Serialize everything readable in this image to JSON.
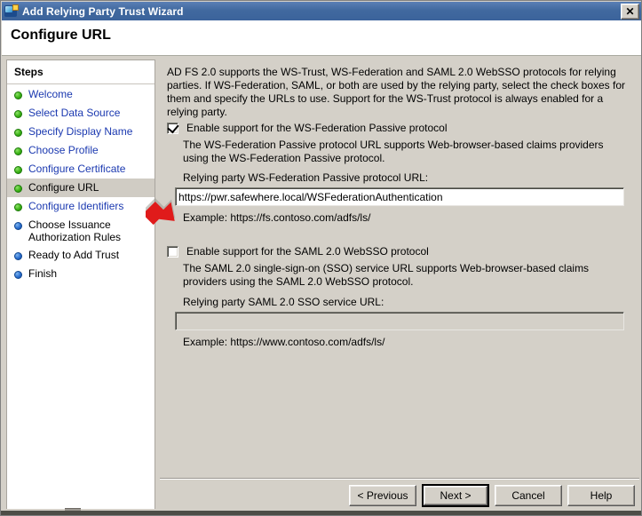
{
  "window": {
    "title": "Add Relying Party Trust Wizard",
    "icon": "network-globe-icon",
    "close_label": "✕"
  },
  "header": {
    "title": "Configure URL"
  },
  "sidebar": {
    "title": "Steps",
    "items": [
      {
        "label": "Welcome",
        "state": "done"
      },
      {
        "label": "Select Data Source",
        "state": "done"
      },
      {
        "label": "Specify Display Name",
        "state": "done"
      },
      {
        "label": "Choose Profile",
        "state": "done"
      },
      {
        "label": "Configure Certificate",
        "state": "done"
      },
      {
        "label": "Configure URL",
        "state": "current"
      },
      {
        "label": "Configure Identifiers",
        "state": "done"
      },
      {
        "label": "Choose Issuance Authorization Rules",
        "state": "todo"
      },
      {
        "label": "Ready to Add Trust",
        "state": "todo"
      },
      {
        "label": "Finish",
        "state": "todo"
      }
    ]
  },
  "main": {
    "intro": "AD FS 2.0 supports the WS-Trust, WS-Federation and SAML 2.0 WebSSO protocols for relying parties.  If WS-Federation, SAML, or both are used by the relying party, select the check boxes for them and specify the URLs to use.  Support for the WS-Trust protocol is always enabled for a relying party.",
    "wsfed": {
      "checkbox_label": "Enable support for the WS-Federation Passive protocol",
      "checked": true,
      "description": "The WS-Federation Passive protocol URL supports Web-browser-based claims providers using the WS-Federation Passive protocol.",
      "field_label": "Relying party WS-Federation Passive protocol URL:",
      "field_value": "https://pwr.safewhere.local/WSFederationAuthentication",
      "example": "Example: https://fs.contoso.com/adfs/ls/"
    },
    "saml": {
      "checkbox_label": "Enable support for the SAML 2.0 WebSSO protocol",
      "checked": false,
      "description": "The SAML 2.0 single-sign-on (SSO) service URL supports Web-browser-based claims providers using the SAML 2.0 WebSSO protocol.",
      "field_label": "Relying party SAML 2.0 SSO service URL:",
      "field_value": "",
      "example": "Example: https://www.contoso.com/adfs/ls/"
    }
  },
  "buttons": {
    "previous": "< Previous",
    "next": "Next >",
    "cancel": "Cancel",
    "help": "Help"
  },
  "annotation": {
    "arrow_color": "#e01b1b",
    "arrow_target": "relying-party-wsfed-url-input"
  }
}
